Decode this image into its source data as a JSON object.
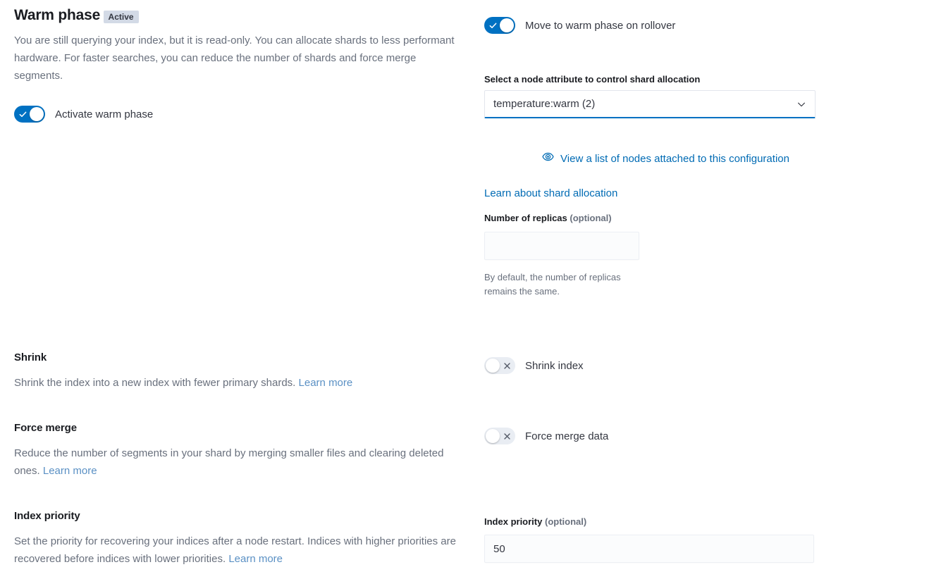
{
  "phase": {
    "title": "Warm phase",
    "status_badge": "Active",
    "description": "You are still querying your index, but it is read-only. You can allocate shards to less performant hardware. For faster searches, you can reduce the number of shards and force merge segments.",
    "activate_toggle_label": "Activate warm phase",
    "activate_toggle_state": "on"
  },
  "rollover": {
    "toggle_label": "Move to warm phase on rollover",
    "toggle_state": "on"
  },
  "allocation": {
    "select_label": "Select a node attribute to control shard allocation",
    "select_value": "temperature:warm (2)",
    "view_nodes_link": "View a list of nodes attached to this configuration",
    "view_nodes_icon": "eye-icon",
    "learn_link": "Learn about shard allocation",
    "replicas_label": "Number of replicas",
    "replicas_optional": "(optional)",
    "replicas_value": "",
    "replicas_helper": "By default, the number of replicas remains the same."
  },
  "shrink": {
    "heading": "Shrink",
    "description": "Shrink the index into a new index with fewer primary shards. ",
    "learn_more": "Learn more",
    "toggle_label": "Shrink index",
    "toggle_state": "off"
  },
  "force_merge": {
    "heading": "Force merge",
    "description": "Reduce the number of segments in your shard by merging smaller files and clearing deleted ones. ",
    "learn_more": "Learn more",
    "toggle_label": "Force merge data",
    "toggle_state": "off"
  },
  "index_priority": {
    "heading": "Index priority",
    "description": "Set the priority for recovering your indices after a node restart. Indices with higher priorities are recovered before indices with lower priorities. ",
    "learn_more": "Learn more",
    "field_label": "Index priority",
    "field_optional": "(optional)",
    "field_value": "50"
  },
  "colors": {
    "accent_blue": "#0071c2",
    "link_blue": "#5a90c4",
    "badge_bg": "#d3dae6",
    "text_dark": "#1a1c21",
    "text_muted": "#69707d"
  }
}
